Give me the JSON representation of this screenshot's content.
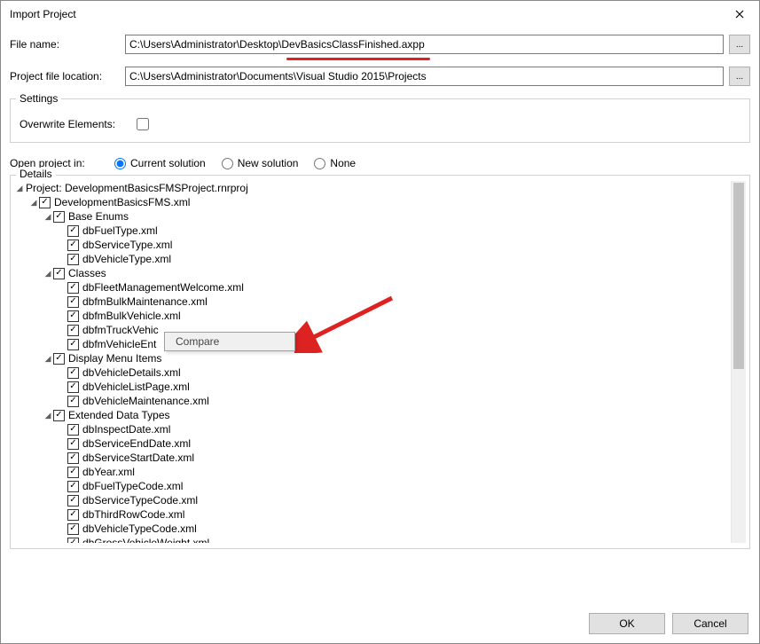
{
  "window": {
    "title": "Import Project"
  },
  "form": {
    "file_name_label": "File name:",
    "file_name_value": "C:\\Users\\Administrator\\Desktop\\DevBasicsClassFinished.axpp",
    "project_location_label": "Project file location:",
    "project_location_value": "C:\\Users\\Administrator\\Documents\\Visual Studio 2015\\Projects",
    "browse_btn": "..."
  },
  "settings": {
    "legend": "Settings",
    "overwrite_label": "Overwrite Elements:",
    "overwrite_checked": false,
    "open_in_label": "Open project in:",
    "radio_current": "Current solution",
    "radio_new": "New solution",
    "radio_none": "None",
    "radio_selected": "current"
  },
  "details": {
    "legend": "Details",
    "tree": [
      {
        "depth": 0,
        "expanded": true,
        "check": false,
        "label": "Project: DevelopmentBasicsFMSProject.rnrproj"
      },
      {
        "depth": 1,
        "expanded": true,
        "check": true,
        "label": "DevelopmentBasicsFMS.xml"
      },
      {
        "depth": 2,
        "expanded": true,
        "check": true,
        "label": "Base Enums"
      },
      {
        "depth": 3,
        "expanded": null,
        "check": true,
        "label": "dbFuelType.xml"
      },
      {
        "depth": 3,
        "expanded": null,
        "check": true,
        "label": "dbServiceType.xml"
      },
      {
        "depth": 3,
        "expanded": null,
        "check": true,
        "label": "dbVehicleType.xml"
      },
      {
        "depth": 2,
        "expanded": true,
        "check": true,
        "label": "Classes"
      },
      {
        "depth": 3,
        "expanded": null,
        "check": true,
        "label": "dbFleetManagementWelcome.xml"
      },
      {
        "depth": 3,
        "expanded": null,
        "check": true,
        "label": "dbfmBulkMaintenance.xml"
      },
      {
        "depth": 3,
        "expanded": null,
        "check": true,
        "label": "dbfmBulkVehicle.xml"
      },
      {
        "depth": 3,
        "expanded": null,
        "check": true,
        "label": "dbfmTruckVehic"
      },
      {
        "depth": 3,
        "expanded": null,
        "check": true,
        "label": "dbfmVehicleEnt"
      },
      {
        "depth": 2,
        "expanded": true,
        "check": true,
        "label": "Display Menu Items"
      },
      {
        "depth": 3,
        "expanded": null,
        "check": true,
        "label": "dbVehicleDetails.xml"
      },
      {
        "depth": 3,
        "expanded": null,
        "check": true,
        "label": "dbVehicleListPage.xml"
      },
      {
        "depth": 3,
        "expanded": null,
        "check": true,
        "label": "dbVehicleMaintenance.xml"
      },
      {
        "depth": 2,
        "expanded": true,
        "check": true,
        "label": "Extended Data Types"
      },
      {
        "depth": 3,
        "expanded": null,
        "check": true,
        "label": "dbInspectDate.xml"
      },
      {
        "depth": 3,
        "expanded": null,
        "check": true,
        "label": "dbServiceEndDate.xml"
      },
      {
        "depth": 3,
        "expanded": null,
        "check": true,
        "label": "dbServiceStartDate.xml"
      },
      {
        "depth": 3,
        "expanded": null,
        "check": true,
        "label": "dbYear.xml"
      },
      {
        "depth": 3,
        "expanded": null,
        "check": true,
        "label": "dbFuelTypeCode.xml"
      },
      {
        "depth": 3,
        "expanded": null,
        "check": true,
        "label": "dbServiceTypeCode.xml"
      },
      {
        "depth": 3,
        "expanded": null,
        "check": true,
        "label": "dbThirdRowCode.xml"
      },
      {
        "depth": 3,
        "expanded": null,
        "check": true,
        "label": "dbVehicleTypeCode.xml"
      },
      {
        "depth": 3,
        "expanded": null,
        "check": true,
        "label": "dbGrossVehicleWeight.xml"
      }
    ]
  },
  "context_menu": {
    "compare": "Compare"
  },
  "footer": {
    "ok": "OK",
    "cancel": "Cancel"
  }
}
